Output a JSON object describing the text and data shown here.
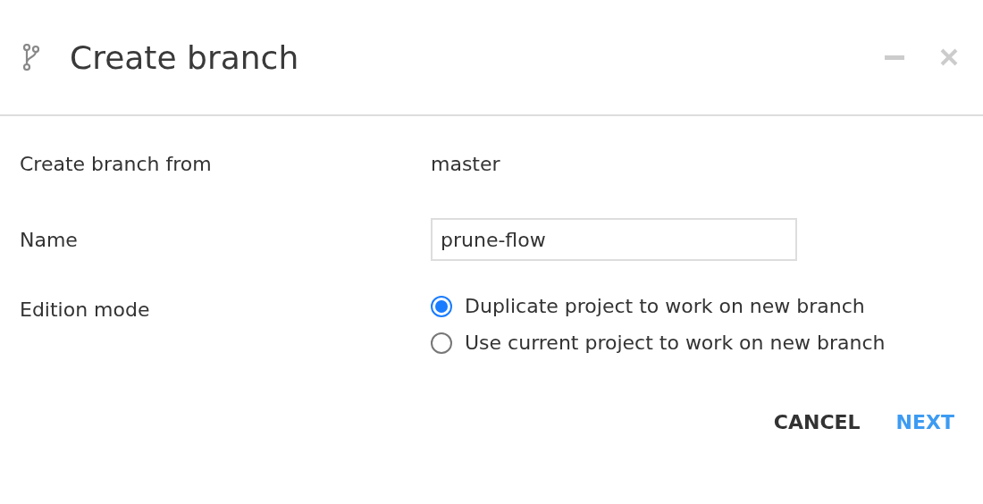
{
  "window": {
    "title": "Create branch"
  },
  "form": {
    "source_label": "Create branch from",
    "source_value": "master",
    "name_label": "Name",
    "name_value": "prune-flow",
    "mode_label": "Edition mode",
    "modes": [
      {
        "label": "Duplicate project to work on new branch",
        "selected": true
      },
      {
        "label": "Use current project to work on new branch",
        "selected": false
      }
    ]
  },
  "buttons": [
    {
      "label": "CANCEL",
      "kind": "secondary"
    },
    {
      "label": "NEXT",
      "kind": "primary"
    }
  ]
}
